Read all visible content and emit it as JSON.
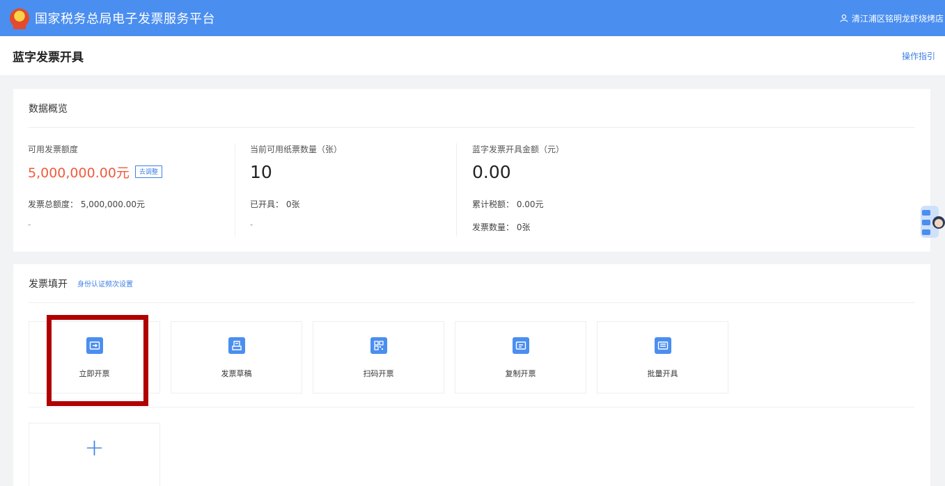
{
  "header": {
    "title": "国家税务总局电子发票服务平台",
    "user": "清江浦区铭明龙虾烧烤店"
  },
  "subheader": {
    "title": "蓝字发票开具",
    "guide_link": "操作指引"
  },
  "overview": {
    "title": "数据概览",
    "quota": {
      "label": "可用发票额度",
      "value": "5,000,000.00元",
      "adjust_label": "去调整",
      "total_line": "发票总额度： 5,000,000.00元",
      "extra": "-"
    },
    "paper": {
      "label": "当前可用纸票数量（张）",
      "value": "10",
      "issued_line": "已开具： 0张",
      "extra": "-"
    },
    "amount": {
      "label": "蓝字发票开具金额（元）",
      "value": "0.00",
      "tax_line": "累计税额： 0.00元",
      "count_line": "发票数量： 0张"
    }
  },
  "fill": {
    "title": "发票填开",
    "settings_link": "身份认证频次设置",
    "tiles": [
      {
        "label": "立即开票",
        "icon": "issue-now-icon"
      },
      {
        "label": "发票草稿",
        "icon": "draft-icon"
      },
      {
        "label": "扫码开票",
        "icon": "qr-code-icon"
      },
      {
        "label": "复制开票",
        "icon": "copy-invoice-icon"
      },
      {
        "label": "批量开具",
        "icon": "batch-issue-icon"
      }
    ],
    "add_symbol": "+"
  },
  "colors": {
    "brand_blue": "#4a8ef0",
    "quota_red": "#f15a3c",
    "highlight_red": "#b00000",
    "link_blue": "#3d7fe6"
  }
}
